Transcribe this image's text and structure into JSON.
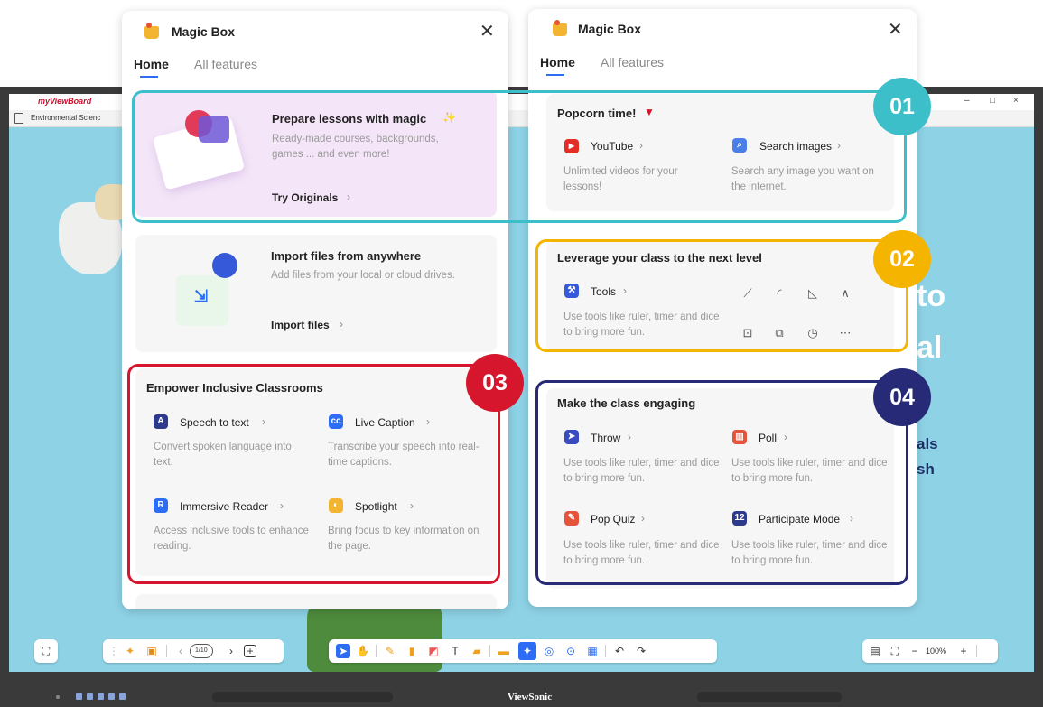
{
  "window": {
    "app_logo": "myViewBoard",
    "tab_label": "Environmental Scienc",
    "controls": [
      "–",
      "□",
      "×"
    ]
  },
  "background": {
    "words": [
      "to",
      "al",
      "als",
      "sh"
    ]
  },
  "toolbar": {
    "pager": "1/10",
    "zoom": "100%"
  },
  "taskbar": {
    "brand": "ViewSonic"
  },
  "panel_left": {
    "title": "Magic Box",
    "tabs": [
      "Home",
      "All features"
    ],
    "card_prepare": {
      "title": "Prepare lessons with magic",
      "sparkle": "✨",
      "desc": "Ready-made courses, backgrounds, games ... and even more!",
      "link": "Try Originals"
    },
    "card_import": {
      "title": "Import files from anywhere",
      "desc": "Add files from your local or cloud drives.",
      "link": "Import files"
    },
    "card_inclusive": {
      "title": "Empower Inclusive Classrooms",
      "items": [
        {
          "label": "Speech to text",
          "desc": "Convert spoken language into text."
        },
        {
          "label": "Live Caption",
          "desc": "Transcribe your speech into real-time captions."
        },
        {
          "label": "Immersive Reader",
          "desc": "Access inclusive tools to enhance reading."
        },
        {
          "label": "Spotlight",
          "desc": "Bring focus to key information on the page."
        }
      ]
    }
  },
  "panel_right": {
    "title": "Magic Box",
    "tabs": [
      "Home",
      "All features"
    ],
    "card_popcorn": {
      "title": "Popcorn time!",
      "items": [
        {
          "label": "YouTube",
          "desc": "Unlimited videos for your lessons!"
        },
        {
          "label": "Search images",
          "desc": "Search any image you want on the internet."
        }
      ]
    },
    "card_leverage": {
      "title": "Leverage your class to the next level",
      "tools_label": "Tools",
      "desc": "Use tools like ruler, timer and dice to bring more fun.",
      "tool_icons": [
        "ruler-icon",
        "protractor-icon",
        "set-square-icon",
        "compass-icon",
        "dice-icon",
        "text-tool-icon",
        "timer-icon",
        "more-icon"
      ]
    },
    "card_engage": {
      "title": "Make the class engaging",
      "items": [
        {
          "label": "Throw",
          "desc": "Use tools like ruler, timer and dice to bring more fun."
        },
        {
          "label": "Poll",
          "desc": "Use tools like ruler, timer and dice to bring more fun."
        },
        {
          "label": "Pop Quiz",
          "desc": "Use tools like ruler, timer and dice to bring more fun."
        },
        {
          "label": "Participate Mode",
          "desc": "Use tools like ruler, timer and dice to bring more fun."
        }
      ]
    }
  },
  "callouts": [
    {
      "num": "01",
      "color": "#3dbfc9"
    },
    {
      "num": "02",
      "color": "#f5b400"
    },
    {
      "num": "03",
      "color": "#d6162c"
    },
    {
      "num": "04",
      "color": "#272b77"
    }
  ]
}
